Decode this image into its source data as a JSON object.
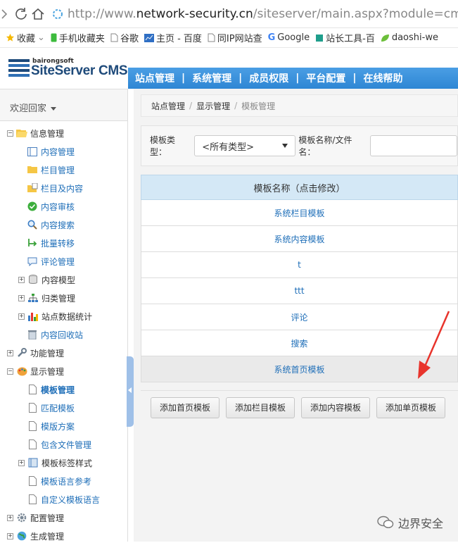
{
  "browser": {
    "url_prefix": "http://www.",
    "url_host": "network-security.cn",
    "url_path": "/siteserver/main.aspx?module=cms",
    "bookmarks": [
      "收藏",
      "手机收藏夹",
      "谷歌",
      "主页 - 百度",
      "同IP网站查",
      "Google",
      "站长工具-百",
      "daoshi-we"
    ]
  },
  "logo": {
    "top": "bairongsoft",
    "main": "SiteServer CMS"
  },
  "topnav": [
    "站点管理",
    "系统管理",
    "成员权限",
    "平台配置",
    "在线帮助"
  ],
  "sidebar": {
    "welcome": "欢迎回家",
    "items": [
      {
        "label": "信息管理"
      },
      {
        "label": "内容管理"
      },
      {
        "label": "栏目管理"
      },
      {
        "label": "栏目及内容"
      },
      {
        "label": "内容审核"
      },
      {
        "label": "内容搜索"
      },
      {
        "label": "批量转移"
      },
      {
        "label": "评论管理"
      },
      {
        "label": "内容模型"
      },
      {
        "label": "归类管理"
      },
      {
        "label": "站点数据统计"
      },
      {
        "label": "内容回收站"
      },
      {
        "label": "功能管理"
      },
      {
        "label": "显示管理"
      },
      {
        "label": "模板管理"
      },
      {
        "label": "匹配模板"
      },
      {
        "label": "模版方案"
      },
      {
        "label": "包含文件管理"
      },
      {
        "label": "模板标签样式"
      },
      {
        "label": "模板语言参考"
      },
      {
        "label": "自定义模板语言"
      },
      {
        "label": "配置管理"
      },
      {
        "label": "生成管理"
      }
    ]
  },
  "breadcrumb": [
    "站点管理",
    "显示管理",
    "模板管理"
  ],
  "filter": {
    "type_label": "模板类型：",
    "type_value": "<所有类型>",
    "name_label": "模板名称/文件名："
  },
  "table": {
    "header": "模板名称（点击修改）",
    "rows": [
      "系统栏目模板",
      "系统内容模板",
      "t",
      "ttt",
      "评论",
      "搜索",
      "系统首页模板"
    ]
  },
  "actions": [
    "添加首页模板",
    "添加栏目模板",
    "添加内容模板",
    "添加单页模板"
  ],
  "watermark": "边界安全",
  "colors": {
    "nav_blue": "#2e86d4",
    "link_blue": "#1e6eb8",
    "annotation_red": "#e8342c"
  }
}
